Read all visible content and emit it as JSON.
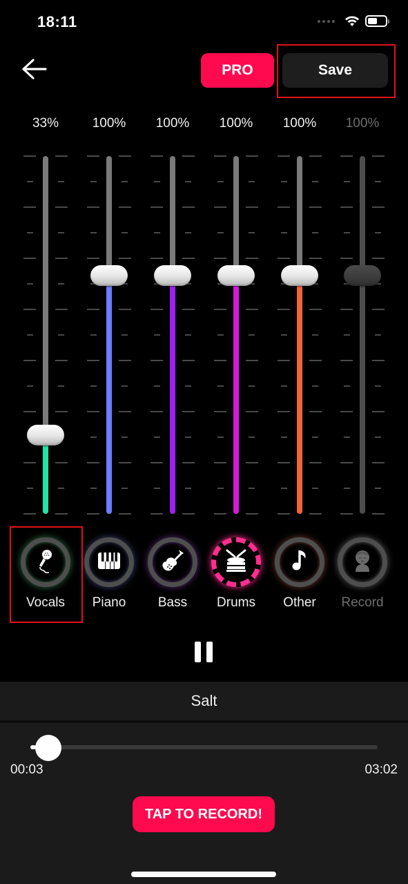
{
  "status_bar": {
    "time": "18:11",
    "battery_level": 0.55
  },
  "top_bar": {
    "back_icon": "arrow-left-icon",
    "pro_label": "PRO",
    "save_label": "Save",
    "pro_color": "#ff0a4f"
  },
  "mixer": {
    "max_percent": 150,
    "channels": [
      {
        "name": "Vocals",
        "percent_label": "33%",
        "value": 33,
        "color": "#1fe6a6",
        "enabled": true,
        "icon": "microphone-icon",
        "ring_color": "#2f6b45"
      },
      {
        "name": "Piano",
        "percent_label": "100%",
        "value": 100,
        "color": "#6f7cff",
        "enabled": true,
        "icon": "piano-keys-icon",
        "ring_color": "#3b4170"
      },
      {
        "name": "Bass",
        "percent_label": "100%",
        "value": 100,
        "color": "#a020f0",
        "enabled": true,
        "icon": "electric-guitar-icon",
        "ring_color": "#5a2c74"
      },
      {
        "name": "Drums",
        "percent_label": "100%",
        "value": 100,
        "color": "#d61ad9",
        "enabled": true,
        "icon": "drum-icon",
        "ring_color": "#ff2f8e",
        "active": true
      },
      {
        "name": "Other",
        "percent_label": "100%",
        "value": 100,
        "color": "#f0643c",
        "enabled": true,
        "icon": "music-note-icon",
        "ring_color": "#6b3a33"
      },
      {
        "name": "Record",
        "percent_label": "100%",
        "value": 100,
        "color": "#4d4d4d",
        "enabled": false,
        "icon": "user-avatar-icon",
        "ring_color": "#5a5a5a"
      }
    ]
  },
  "playback": {
    "state": "playing",
    "song_title": "Salt",
    "current_time": "00:03",
    "total_time": "03:02",
    "progress": 0.016
  },
  "record_button_label": "TAP TO RECORD!"
}
